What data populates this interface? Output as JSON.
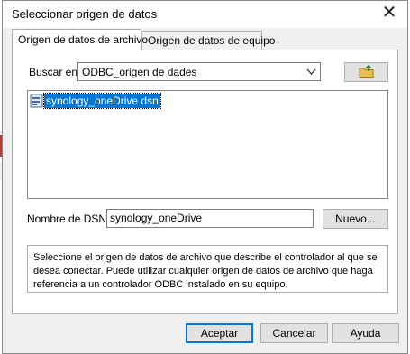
{
  "dialog": {
    "title": "Seleccionar origen de datos",
    "close_glyph": "✕"
  },
  "tabs": [
    {
      "label": "Origen de datos de archivo"
    },
    {
      "label": "Origen de datos de equipo"
    }
  ],
  "file_tab": {
    "look_in_label": "Buscar en:",
    "look_in_value": "ODBC_origen de dades",
    "files": [
      {
        "name": "synology_oneDrive.dsn"
      }
    ],
    "dsn_label": "Nombre de DSN:",
    "dsn_value": "synology_oneDrive",
    "new_button": "Nuevo...",
    "description": "Seleccione el origen de datos de archivo que describe el controlador al que se desea conectar. Puede utilizar cualquier origen de datos de archivo que haga referencia a un controlador ODBC instalado en su equipo."
  },
  "footer": {
    "accept": "Aceptar",
    "cancel": "Cancelar",
    "help": "Ayuda"
  },
  "colors": {
    "selection": "#0078d7",
    "dialog_bg": "#f0f0f0",
    "folder_yellow": "#e8c04a"
  }
}
